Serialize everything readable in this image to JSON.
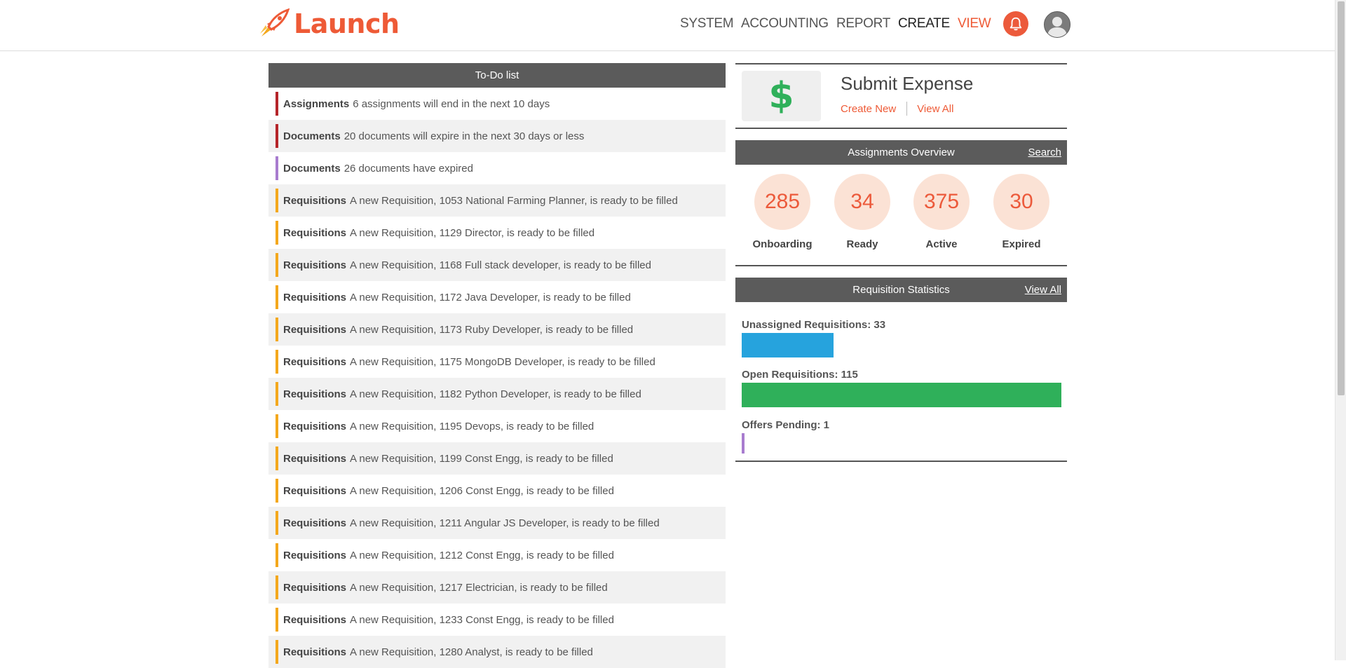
{
  "app": {
    "brand": "Launch",
    "brand_color": "#ee5a36"
  },
  "nav": {
    "items": [
      "SYSTEM",
      "ACCOUNTING",
      "REPORT",
      "CREATE",
      "VIEW"
    ],
    "notification_icon": "bell-icon",
    "avatar_icon": "user-avatar-icon"
  },
  "todo": {
    "title": "To-Do list",
    "items": [
      {
        "category": "Assignments",
        "text": "6 assignments will end in the next 10 days",
        "color": "#b5252a"
      },
      {
        "category": "Documents",
        "text": "20 documents will expire in the next 30 days or less",
        "color": "#b5252a"
      },
      {
        "category": "Documents",
        "text": "26 documents have expired",
        "color": "#a87ccf"
      },
      {
        "category": "Requisitions",
        "text": "A new Requisition, 1053 National Farming Planner, is ready to be filled",
        "color": "#f4a81d"
      },
      {
        "category": "Requisitions",
        "text": "A new Requisition, 1129 Director, is ready to be filled",
        "color": "#f4a81d"
      },
      {
        "category": "Requisitions",
        "text": "A new Requisition, 1168 Full stack developer, is ready to be filled",
        "color": "#f4a81d"
      },
      {
        "category": "Requisitions",
        "text": "A new Requisition, 1172 Java Developer, is ready to be filled",
        "color": "#f4a81d"
      },
      {
        "category": "Requisitions",
        "text": "A new Requisition, 1173 Ruby Developer, is ready to be filled",
        "color": "#f4a81d"
      },
      {
        "category": "Requisitions",
        "text": "A new Requisition, 1175 MongoDB Developer, is ready to be filled",
        "color": "#f4a81d"
      },
      {
        "category": "Requisitions",
        "text": "A new Requisition, 1182 Python Developer, is ready to be filled",
        "color": "#f4a81d"
      },
      {
        "category": "Requisitions",
        "text": "A new Requisition, 1195 Devops, is ready to be filled",
        "color": "#f4a81d"
      },
      {
        "category": "Requisitions",
        "text": "A new Requisition, 1199 Const Engg, is ready to be filled",
        "color": "#f4a81d"
      },
      {
        "category": "Requisitions",
        "text": "A new Requisition, 1206 Const Engg, is ready to be filled",
        "color": "#f4a81d"
      },
      {
        "category": "Requisitions",
        "text": "A new Requisition, 1211 Angular JS Developer, is ready to be filled",
        "color": "#f4a81d"
      },
      {
        "category": "Requisitions",
        "text": "A new Requisition, 1212 Const Engg, is ready to be filled",
        "color": "#f4a81d"
      },
      {
        "category": "Requisitions",
        "text": "A new Requisition, 1217 Electrician, is ready to be filled",
        "color": "#f4a81d"
      },
      {
        "category": "Requisitions",
        "text": "A new Requisition, 1233 Const Engg, is ready to be filled",
        "color": "#f4a81d"
      },
      {
        "category": "Requisitions",
        "text": "A new Requisition, 1280 Analyst, is ready to be filled",
        "color": "#f4a81d"
      }
    ]
  },
  "expense": {
    "title": "Submit Expense",
    "icon": "dollar-icon",
    "create_label": "Create New",
    "view_label": "View All"
  },
  "assignments": {
    "title": "Assignments Overview",
    "search_label": "Search",
    "stats": [
      {
        "value": "285",
        "label": "Onboarding"
      },
      {
        "value": "34",
        "label": "Ready"
      },
      {
        "value": "375",
        "label": "Active"
      },
      {
        "value": "30",
        "label": "Expired"
      }
    ]
  },
  "requisitions": {
    "title": "Requisition Statistics",
    "view_all_label": "View All",
    "bars": [
      {
        "label": "Unassigned Requisitions: 33",
        "value": 33,
        "color": "#26a3dd"
      },
      {
        "label": "Open Requisitions: 115",
        "value": 115,
        "color": "#2fb05a"
      },
      {
        "label": "Offers Pending: 1",
        "value": 1,
        "color": "#a87ccf"
      }
    ]
  }
}
